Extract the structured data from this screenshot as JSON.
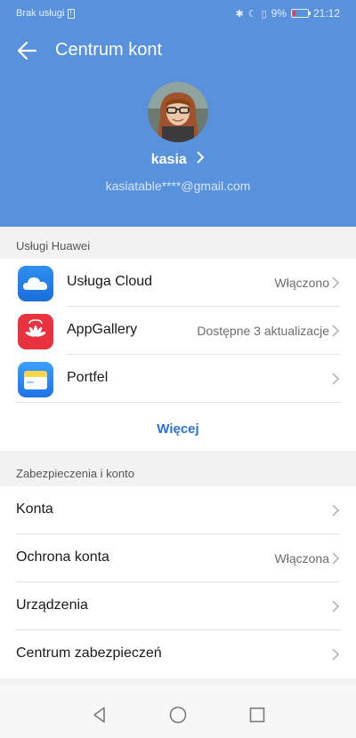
{
  "status_bar": {
    "carrier": "Brak usługi",
    "battery_percent": "9%",
    "time": "21:12"
  },
  "header": {
    "title": "Centrum kont",
    "username": "kasia",
    "email": "kasiatable****@gmail.com",
    "background_color": "#5891dc"
  },
  "huawei_services": {
    "section_label": "Usługi Huawei",
    "items": [
      {
        "label": "Usługa Cloud",
        "value": "Włączono",
        "icon": "cloud-icon"
      },
      {
        "label": "AppGallery",
        "value": "Dostępne 3 aktualizacje",
        "icon": "appgallery-icon"
      },
      {
        "label": "Portfel",
        "value": "",
        "icon": "wallet-icon"
      }
    ],
    "more_label": "Więcej"
  },
  "security": {
    "section_label": "Zabezpieczenia i konto",
    "items": [
      {
        "label": "Konta",
        "value": ""
      },
      {
        "label": "Ochrona konta",
        "value": "Włączona"
      },
      {
        "label": "Urządzenia",
        "value": ""
      },
      {
        "label": "Centrum zabezpieczeń",
        "value": ""
      }
    ]
  },
  "nav": {
    "back": "back-triangle-icon",
    "home": "home-circle-icon",
    "recents": "recents-square-icon"
  },
  "colors": {
    "accent": "#2a73d0",
    "battery_low": "#ff3b30"
  }
}
